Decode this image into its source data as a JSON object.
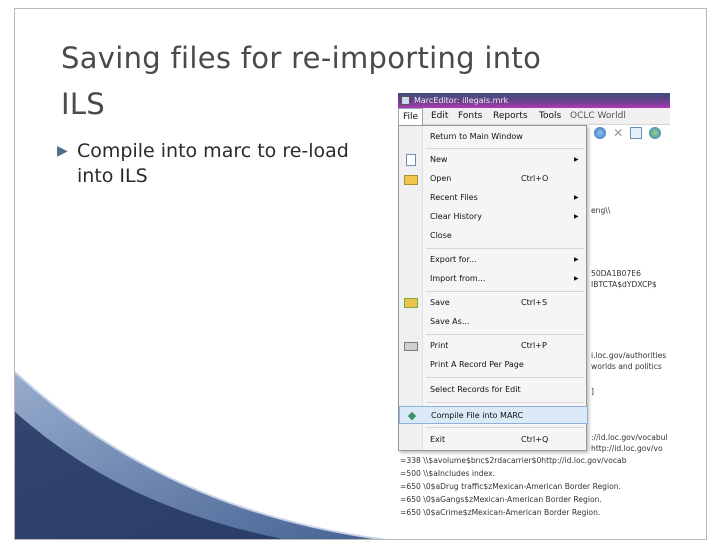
{
  "slide": {
    "title": "Saving files for re-importing into\nILS",
    "bullet": "Compile into marc to re-load into ILS"
  },
  "app": {
    "window_title": "MarcEditor: illegals.mrk",
    "menu": [
      "File",
      "Edit",
      "Fonts",
      "Reports",
      "Tools",
      "OCLC Worldl"
    ],
    "file_menu": {
      "items": [
        {
          "label": "Return to Main Window",
          "shortcut": "",
          "submenu": false,
          "icon": ""
        },
        {
          "label": "New",
          "shortcut": "",
          "submenu": true,
          "icon": "new-file-icon"
        },
        {
          "label": "Open",
          "shortcut": "Ctrl+O",
          "submenu": false,
          "icon": "folder-open-icon"
        },
        {
          "label": "Recent Files",
          "shortcut": "",
          "submenu": true,
          "icon": ""
        },
        {
          "label": "Clear History",
          "shortcut": "",
          "submenu": true,
          "icon": ""
        },
        {
          "label": "Close",
          "shortcut": "",
          "submenu": false,
          "icon": ""
        },
        {
          "label": "Export for...",
          "shortcut": "",
          "submenu": true,
          "icon": ""
        },
        {
          "label": "Import from...",
          "shortcut": "",
          "submenu": true,
          "icon": ""
        },
        {
          "label": "Save",
          "shortcut": "Ctrl+S",
          "submenu": false,
          "icon": "save-icon"
        },
        {
          "label": "Save As...",
          "shortcut": "",
          "submenu": false,
          "icon": ""
        },
        {
          "label": "Print",
          "shortcut": "Ctrl+P",
          "submenu": false,
          "icon": "printer-icon"
        },
        {
          "label": "Print A Record Per Page",
          "shortcut": "",
          "submenu": false,
          "icon": ""
        },
        {
          "label": "Select Records for Edit",
          "shortcut": "",
          "submenu": false,
          "icon": ""
        },
        {
          "label": "Compile File into MARC",
          "shortcut": "",
          "submenu": false,
          "icon": "compile-gem-icon",
          "highlighted": true
        },
        {
          "label": "Exit",
          "shortcut": "Ctrl+Q",
          "submenu": false,
          "icon": ""
        }
      ]
    },
    "editor_fragments": {
      "f1": "eng\\\\",
      "f2": "50DA1B07E6",
      "f3": "IBTCTA$dYDXCP$",
      "f4": "i.loc.gov/authorities",
      "f5": "worlds and politics",
      "f6": "]",
      "f7": "://id.loc.gov/vocabul",
      "f8": "http://id.loc.gov/vo"
    },
    "editor_lines": [
      "=338  \\\\$avolume$bnc$2rdacarrier$0http://id.loc.gov/vocab",
      "=500  \\\\$aIncludes index.",
      "=650  \\0$aDrug traffic$zMexican-American Border Region.",
      "=650  \\0$aGangs$zMexican-American Border Region.",
      "=650  \\0$aCrime$zMexican-American Border Region."
    ]
  }
}
